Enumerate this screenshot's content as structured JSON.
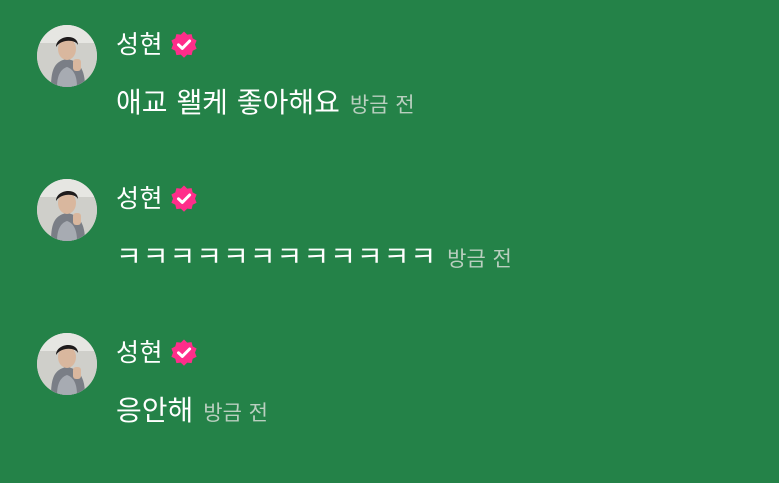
{
  "colors": {
    "background": "#248248",
    "message_text": "#ffffff",
    "timestamp_text": "#b9cfbf",
    "verified_badge": "#ff2d8a"
  },
  "messages": [
    {
      "author": "성현",
      "avatar_icon": "profile-photo",
      "badge_icon": "verified-badge-icon",
      "text": "애교 왤케 좋아해요",
      "time": "방금 전"
    },
    {
      "author": "성현",
      "avatar_icon": "profile-photo",
      "badge_icon": "verified-badge-icon",
      "text": "ㅋㅋㅋㅋㅋㅋㅋㅋㅋㅋㅋㅋ",
      "time": "방금 전"
    },
    {
      "author": "성현",
      "avatar_icon": "profile-photo",
      "badge_icon": "verified-badge-icon",
      "text": "응안해",
      "time": "방금 전"
    }
  ]
}
